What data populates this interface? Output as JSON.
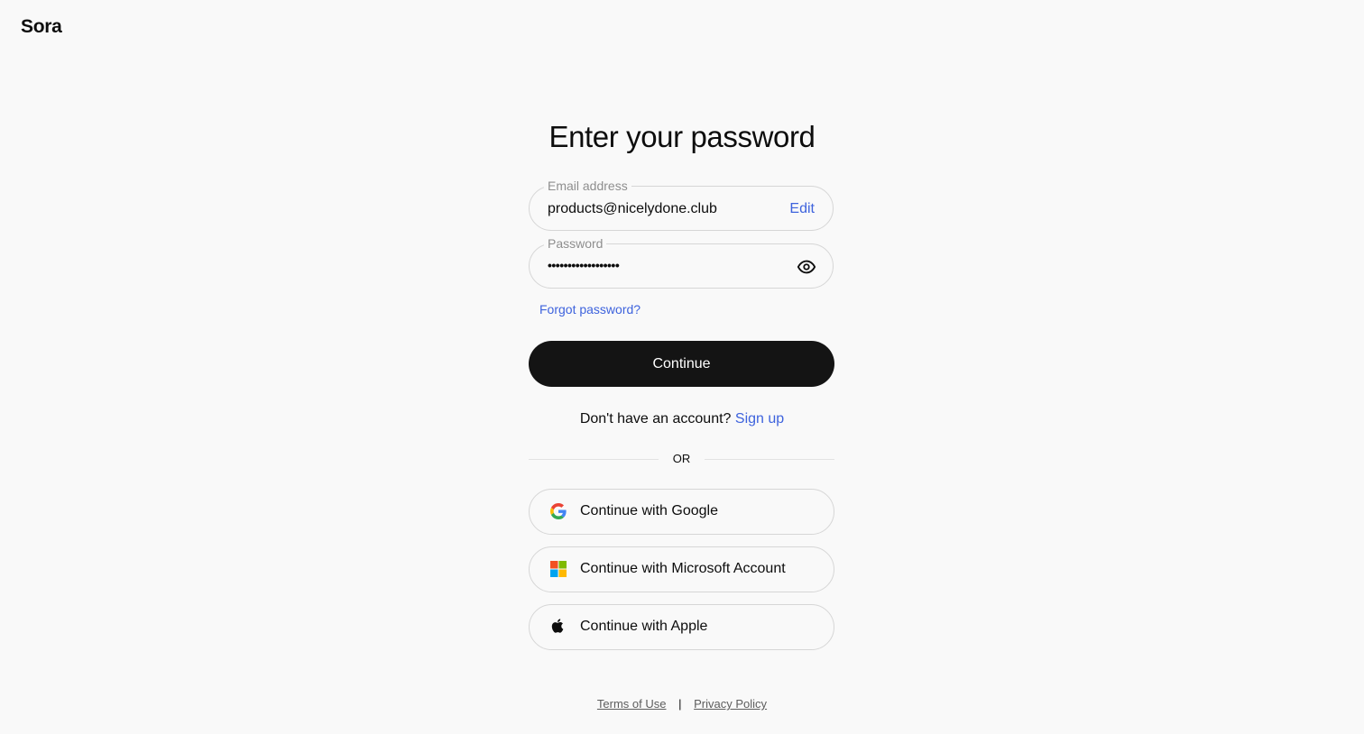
{
  "brand": {
    "logo_text": "Sora"
  },
  "page": {
    "title": "Enter your password"
  },
  "email_field": {
    "label": "Email address",
    "value": "products@nicelydone.club",
    "edit_label": "Edit"
  },
  "password_field": {
    "label": "Password",
    "masked_value": "••••••••••••••••••",
    "visibility_icon": "eye-icon"
  },
  "links": {
    "forgot_password": "Forgot password?",
    "no_account_text": "Don't have an account?",
    "sign_up": "Sign up"
  },
  "buttons": {
    "continue": "Continue"
  },
  "divider": {
    "text": "OR"
  },
  "social": [
    {
      "label": "Continue with Google",
      "icon": "google-icon"
    },
    {
      "label": "Continue with Microsoft Account",
      "icon": "microsoft-icon"
    },
    {
      "label": "Continue with Apple",
      "icon": "apple-icon"
    }
  ],
  "footer": {
    "terms": "Terms of Use",
    "separator": "|",
    "privacy": "Privacy Policy"
  },
  "colors": {
    "background": "#f9f9f9",
    "link": "#3e63dd",
    "primary_button": "#141414",
    "border": "#d6d6d6"
  }
}
